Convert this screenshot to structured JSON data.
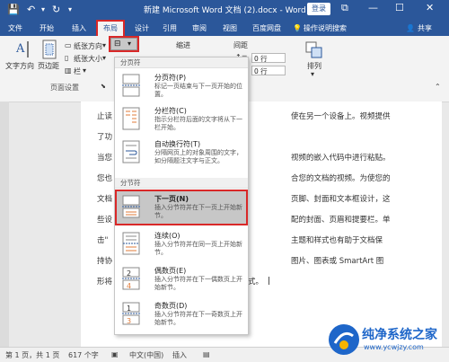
{
  "titlebar": {
    "title": "新建 Microsoft Word 文档 (2).docx - Word",
    "login": "登录"
  },
  "tabs": [
    "文件",
    "开始",
    "插入",
    "布局",
    "设计",
    "引用",
    "审阅",
    "视图",
    "百度网盘",
    "操作说明搜索",
    "共享"
  ],
  "ribbon": {
    "text_direction": "文字方向",
    "margins": "页边距",
    "orientation": "纸张方向",
    "size": "纸张大小",
    "columns": "栏",
    "page_setup_group": "页面设置",
    "indent": "缩进",
    "spacing": "间距",
    "spacing_before": "0 行",
    "spacing_after": "0 行",
    "arrange": "排列"
  },
  "menu": {
    "page_breaks_header": "分页符",
    "section_breaks_header": "分节符",
    "items": [
      {
        "title": "分页符(P)",
        "desc": "标记一页结束与下一页开始的位置。"
      },
      {
        "title": "分栏符(C)",
        "desc": "指示分栏符后面的文字将从下一栏开始。"
      },
      {
        "title": "自动换行符(T)",
        "desc": "分隔网页上的对象周围的文字，如分隔题注文字与正文。"
      },
      {
        "title": "下一页(N)",
        "desc": "插入分节符并在下一页上开始新节。"
      },
      {
        "title": "连续(O)",
        "desc": "插入分节符并在同一页上开始新节。"
      },
      {
        "title": "偶数页(E)",
        "desc": "插入分节符并在下一偶数页上开始新节。"
      },
      {
        "title": "奇数页(D)",
        "desc": "插入分节符并在下一奇数页上开始新节。"
      }
    ]
  },
  "document": {
    "lines": [
      "止读",
      "使在另一个设备上。视频提供",
      "了功",
      "当您",
      "视频的嵌入代码中进行粘贴。",
      "您也",
      "合您的文档的视频。为使您的",
      "文档",
      "页脚、封面和文本框设计，这",
      "些设",
      "配的封面、页眉和提要栏。单",
      "击\"",
      "主题和样式也有助于文档保",
      "持协",
      "图片、图表或 SmartArt 图",
      "形将",
      "式。"
    ]
  },
  "status": {
    "page": "第 1 页，共 1 页",
    "words": "617 个字",
    "language": "中文(中国)",
    "mode": "插入",
    "zoom": "100%"
  },
  "watermark": {
    "title": "纯净系统之家",
    "url": "www.ycwjzy.com"
  },
  "colors": {
    "accent": "#2b579a",
    "highlight": "#d92828"
  }
}
